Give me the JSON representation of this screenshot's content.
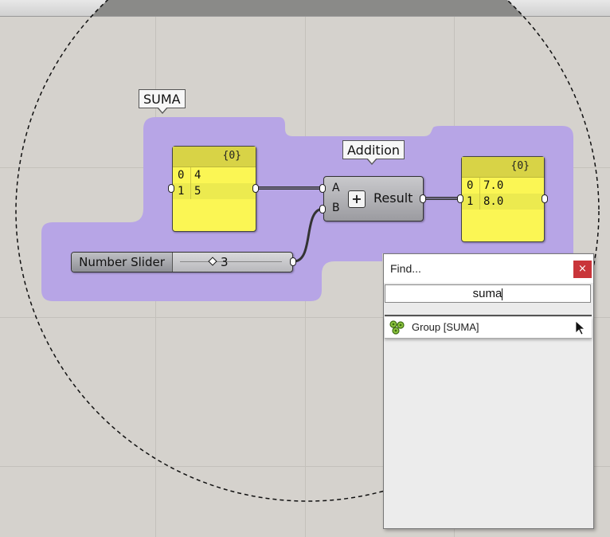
{
  "canvas": {
    "colors": {
      "background": "#d5d2cd",
      "group_fill": "#b7a5e6",
      "panel_fill": "#fbf654",
      "dialog_close": "#c9353a"
    }
  },
  "group": {
    "label": "SUMA"
  },
  "panel_inputs": {
    "header": "{0}",
    "rows": [
      {
        "index": "0",
        "value": "4"
      },
      {
        "index": "1",
        "value": "5"
      }
    ]
  },
  "panel_outputs": {
    "header": "{0}",
    "rows": [
      {
        "index": "0",
        "value": "7.0"
      },
      {
        "index": "1",
        "value": "8.0"
      }
    ]
  },
  "addition": {
    "tag": "Addition",
    "input_a": "A",
    "input_b": "B",
    "operator_icon": "plus-icon",
    "operator": "+",
    "output": "Result"
  },
  "slider": {
    "name": "Number Slider",
    "value": "3"
  },
  "find_dialog": {
    "title": "Find...",
    "close_label": "×",
    "query": "suma",
    "results": [
      {
        "icon": "group-icon",
        "label": "Group [SUMA]"
      }
    ]
  }
}
